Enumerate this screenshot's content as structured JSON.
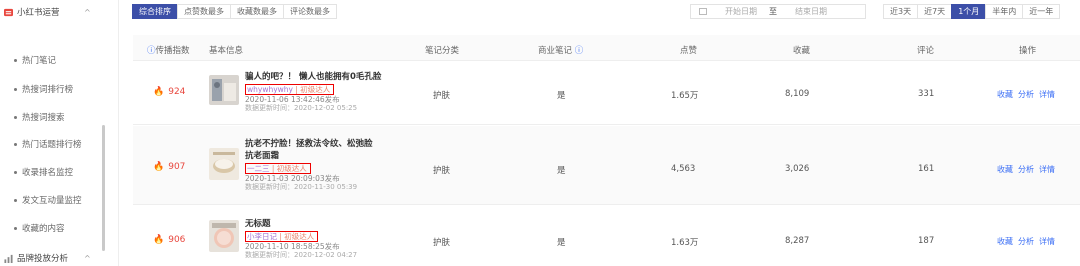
{
  "sidebar": {
    "groups": [
      {
        "label": "小红书运营",
        "icon": "xiaohongshu-icon",
        "chevron": "^"
      },
      {
        "label": "品牌投放分析",
        "icon": "chart-icon",
        "chevron": "^"
      }
    ],
    "items": [
      {
        "label": "热门笔记"
      },
      {
        "label": "热搜词排行榜"
      },
      {
        "label": "热搜词搜索"
      },
      {
        "label": "热门话题排行榜"
      },
      {
        "label": "收录排名监控"
      },
      {
        "label": "发文互动量监控"
      },
      {
        "label": "收藏的内容"
      }
    ]
  },
  "sort_tabs": [
    {
      "label": "综合排序",
      "active": true
    },
    {
      "label": "点赞数最多",
      "active": false
    },
    {
      "label": "收藏数最多",
      "active": false
    },
    {
      "label": "评论数最多",
      "active": false
    }
  ],
  "date_filter": {
    "start_placeholder": "开始日期",
    "separator": "至",
    "end_placeholder": "结束日期"
  },
  "range_tabs": [
    {
      "label": "近3天",
      "active": false
    },
    {
      "label": "近7天",
      "active": false
    },
    {
      "label": "1个月",
      "active": true
    },
    {
      "label": "半年内",
      "active": false
    },
    {
      "label": "近一年",
      "active": false
    }
  ],
  "table": {
    "headers": {
      "spread": "传播指数",
      "basic": "基本信息",
      "category": "笔记分类",
      "commercial": "商业笔记",
      "likes": "点赞",
      "favorites": "收藏",
      "comments": "评论",
      "actions": "操作"
    },
    "rows": [
      {
        "score": "924",
        "title1": "骗人的吧？！ 懒人也能拥有0毛孔脸",
        "title2": "",
        "author": "whywhywhy",
        "level": "初级达人",
        "published": "2020-11-06 13:42:46发布",
        "updated": "数据更新时间：2020-12-02 05:25",
        "category": "护肤",
        "commercial": "是",
        "likes": "1.65万",
        "favorites": "8,109",
        "comments": "331",
        "actions": [
          "收藏",
          "分析",
          "详情"
        ]
      },
      {
        "score": "907",
        "title1": "抗老不拧脸！拯救法令纹、松弛脸",
        "title2": "抗老面霜",
        "author": "一二三",
        "level": "初级达人",
        "published": "2020-11-03 20:09:03发布",
        "updated": "数据更新时间：2020-11-30 05:39",
        "category": "护肤",
        "commercial": "是",
        "likes": "4,563",
        "favorites": "3,026",
        "comments": "161",
        "actions": [
          "收藏",
          "分析",
          "详情"
        ]
      },
      {
        "score": "906",
        "title1": "无标题",
        "title2": "",
        "author": "小李日记",
        "level": "初级达人",
        "published": "2020-11-10 18:58:25发布",
        "updated": "数据更新时间：2020-12-02 04:27",
        "category": "护肤",
        "commercial": "是",
        "likes": "1.63万",
        "favorites": "8,287",
        "comments": "187",
        "actions": [
          "收藏",
          "分析",
          "详情"
        ]
      }
    ]
  },
  "colors": {
    "primary": "#3c4fa8",
    "link": "#3c6ff5",
    "score": "#e8473e",
    "highlight_box": "#e00000"
  }
}
